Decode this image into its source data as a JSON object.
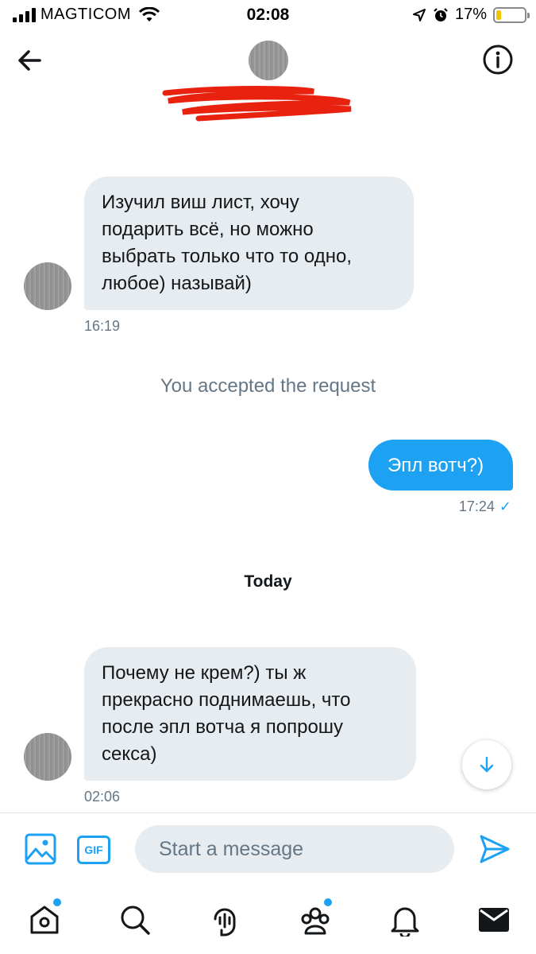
{
  "status_bar": {
    "carrier": "MAGTICOM",
    "time": "02:08",
    "battery_percent": "17%",
    "battery_level": 0.17,
    "icons": [
      "signal-icon",
      "wifi-icon",
      "location-arrow-icon",
      "alarm-icon",
      "battery-icon"
    ]
  },
  "header": {
    "back_icon": "arrow-left-icon",
    "info_icon": "info-icon"
  },
  "messages": [
    {
      "direction": "incoming",
      "text_lines": [
        "Изучил виш лист, хочу",
        "подарить всё, но можно",
        "выбрать только что то одно,",
        "любое) называй)"
      ],
      "time": "16:19"
    },
    {
      "direction": "outgoing",
      "text": "Эпл вотч?)",
      "time": "17:24",
      "status_icon": "check-icon",
      "status_mark": "✓"
    },
    {
      "direction": "incoming",
      "text_lines": [
        "Почему не крем?) ты ж",
        "прекрасно поднимаешь, что",
        "после эпл вотча я попрошу",
        "секса)"
      ],
      "time": "02:06"
    }
  ],
  "system_note": "You accepted the request",
  "day_separator": "Today",
  "composer": {
    "placeholder": "Start a message",
    "gif_label": "GIF",
    "media_icon": "image-icon",
    "send_icon": "send-icon"
  },
  "tabbar": {
    "items": [
      "home",
      "search",
      "spaces",
      "communities",
      "notifications",
      "messages"
    ],
    "accent": "#1da1f2"
  },
  "colors": {
    "accent": "#1da1f2",
    "incoming_bubble": "#e6ecf0",
    "secondary_text": "#657786"
  }
}
